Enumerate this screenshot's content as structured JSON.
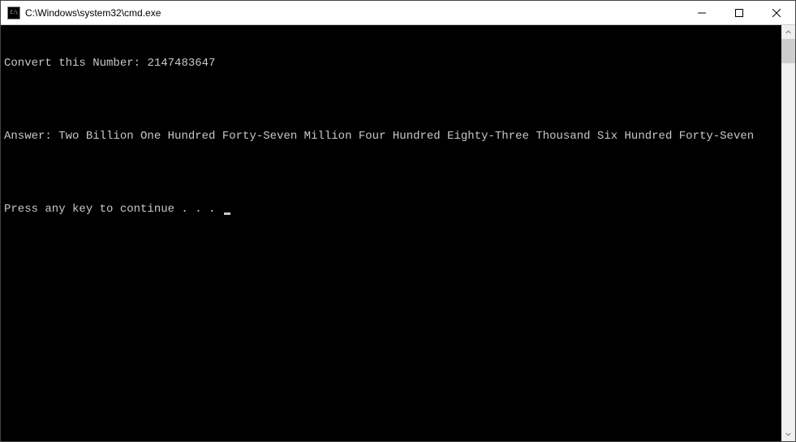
{
  "window": {
    "title": "C:\\Windows\\system32\\cmd.exe"
  },
  "console": {
    "line1_label": "Convert this Number: ",
    "line1_value": "2147483647",
    "blank1": "",
    "line2_label": "Answer: ",
    "line2_value": "Two Billion One Hundred Forty-Seven Million Four Hundred Eighty-Three Thousand Six Hundred Forty-Seven",
    "blank2": "",
    "line3": "Press any key to continue . . . "
  }
}
